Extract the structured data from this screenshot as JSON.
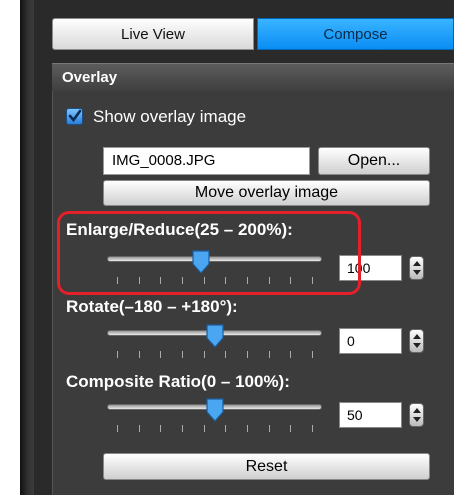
{
  "tabs": [
    {
      "label": "Live View",
      "active": false
    },
    {
      "label": "Compose",
      "active": true
    }
  ],
  "section_title": "Overlay",
  "show_overlay": {
    "label": "Show overlay image",
    "checked": true
  },
  "file": {
    "name": "IMG_0008.JPG",
    "open_label": "Open...",
    "move_label": "Move overlay image"
  },
  "enlarge": {
    "label": "Enlarge/Reduce(25 – 200%):",
    "value": "100",
    "min": 25,
    "max": 200,
    "level": 100
  },
  "rotate": {
    "label": "Rotate(–180 – +180°):",
    "value": "0",
    "min": -180,
    "max": 180,
    "level": 0
  },
  "composite": {
    "label": "Composite Ratio(0 – 100%):",
    "value": "50",
    "min": 0,
    "max": 100,
    "level": 50
  },
  "reset_label": "Reset",
  "colors": {
    "accent": "#1a9bff",
    "highlight": "#e4202a",
    "panel": "#3c3c3c"
  },
  "icons": [
    "checkmark-icon",
    "slider-thumb-icon",
    "stepper-arrows-icon"
  ]
}
